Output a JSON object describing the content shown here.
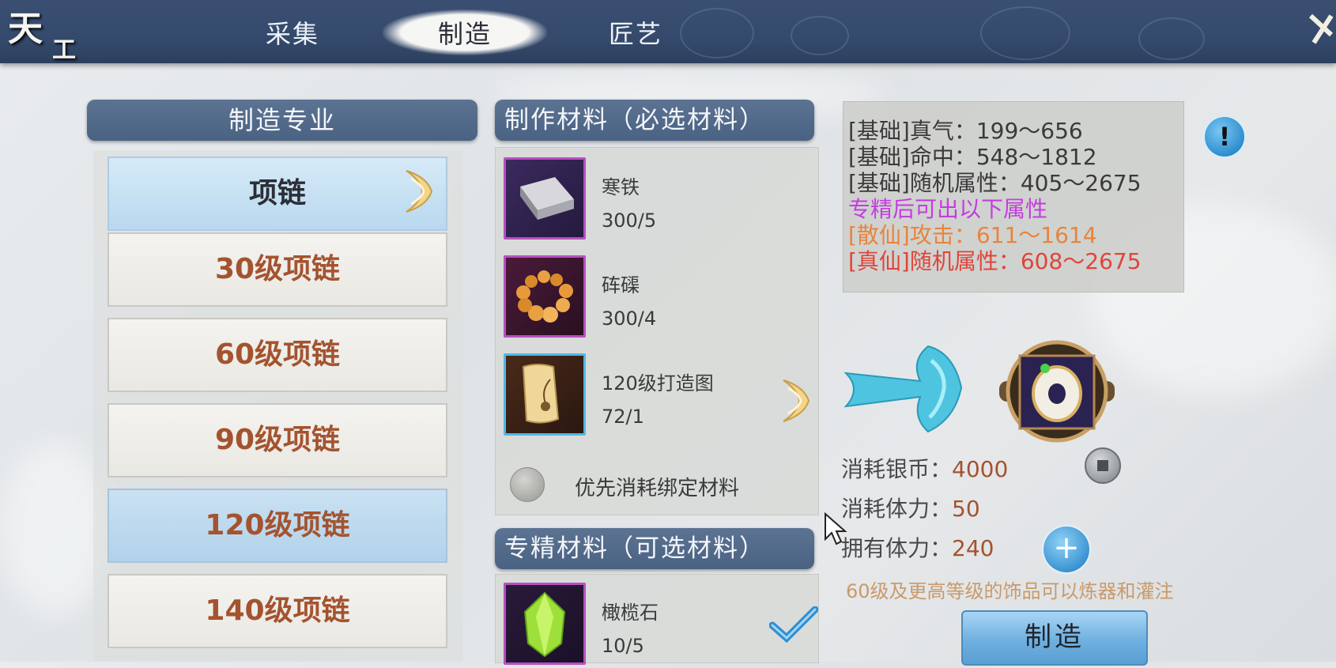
{
  "header": {
    "logo_1": "天",
    "logo_2": "工",
    "tabs": [
      {
        "label": "采集"
      },
      {
        "label": "制造"
      },
      {
        "label": "匠艺"
      }
    ]
  },
  "left_panel": {
    "title": "制造专业",
    "category": "项链",
    "items": [
      "30级项链",
      "60级项链",
      "90级项链",
      "120级项链",
      "140级项链"
    ],
    "selected_index": 3
  },
  "required_materials": {
    "title": "制作材料（必选材料）",
    "items": [
      {
        "name": "寒铁",
        "count": "300/5"
      },
      {
        "name": "砗磲",
        "count": "300/4"
      },
      {
        "name": "120级打造图",
        "count": "72/1"
      }
    ],
    "bind_option": "优先消耗绑定材料"
  },
  "optional_materials": {
    "title": "专精材料（可选材料）",
    "items": [
      {
        "name": "橄榄石",
        "count": "10/5",
        "checked": true
      }
    ]
  },
  "stats": {
    "lines": [
      {
        "text": "[基础]真气：199～656",
        "color": "#3a3a3a"
      },
      {
        "text": "[基础]命中：548～1812",
        "color": "#3a3a3a"
      },
      {
        "text": "[基础]随机属性：405～2675",
        "color": "#3a3a3a"
      },
      {
        "text": "专精后可出以下属性",
        "color": "#c43de0"
      },
      {
        "text": "[散仙]攻击：611～1614",
        "color": "#e8843a"
      },
      {
        "text": "[真仙]随机属性：608～2675",
        "color": "#e0443a"
      }
    ]
  },
  "costs": {
    "silver_label": "消耗银币：",
    "silver_value": "4000",
    "stamina_label": "消耗体力：",
    "stamina_value": "50",
    "owned_label": "拥有体力：",
    "owned_value": "240"
  },
  "note": "60级及更高等级的饰品可以炼器和灌注",
  "craft_button": "制造",
  "icons": [
    "info-icon",
    "plus-icon",
    "coin-icon",
    "arrow-right-icon",
    "checkmark-icon",
    "close-icon"
  ]
}
